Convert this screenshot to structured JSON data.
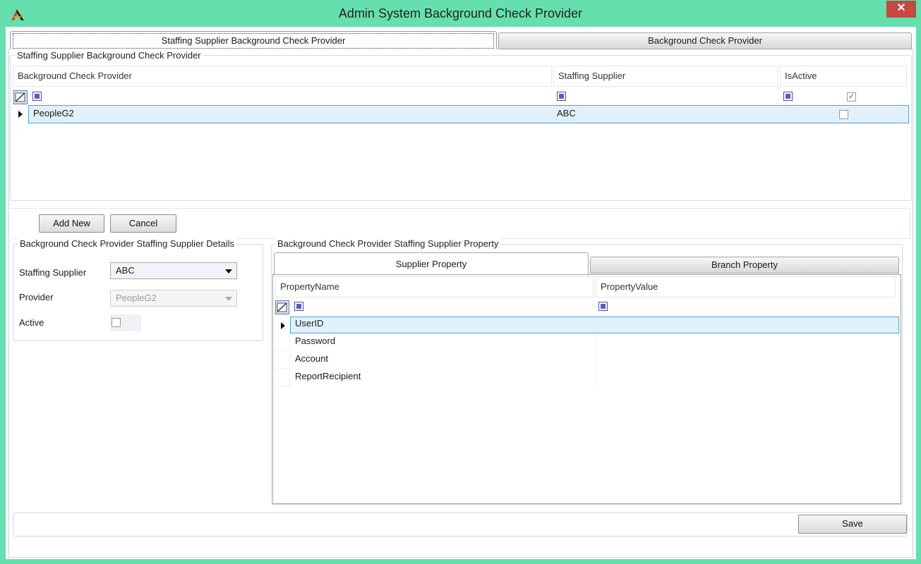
{
  "window": {
    "title": "Admin System Background Check Provider",
    "close_glyph": "✕",
    "app_icon": "app-logo-icon"
  },
  "tabs": {
    "active": "Staffing Supplier Background Check Provider",
    "inactive": "Background Check Provider"
  },
  "grid_group": {
    "label": "Staffing Supplier Background Check Provider",
    "columns": [
      "Background Check Provider",
      "Staffing Supplier",
      "IsActive"
    ],
    "rows": [
      {
        "provider": "PeopleG2",
        "supplier": "ABC",
        "is_active": false
      }
    ]
  },
  "actions": {
    "add_new": "Add New",
    "cancel": "Cancel",
    "save": "Save"
  },
  "details": {
    "label": "Background Check Provider Staffing Supplier Details",
    "staffing_supplier_label": "Staffing Supplier",
    "staffing_supplier_value": "ABC",
    "provider_label": "Provider",
    "provider_value": "PeopleG2",
    "active_label": "Active"
  },
  "property": {
    "label": "Background Check Provider Staffing Supplier Property",
    "tab_active": "Supplier Property",
    "tab_inactive": "Branch Property",
    "columns": [
      "PropertyName",
      "PropertyValue"
    ],
    "rows": [
      "UserID",
      "Password",
      "Account",
      "ReportRecipient"
    ]
  },
  "colors": {
    "titlebar": "#66dfaf",
    "close": "#c7483f",
    "selection": "#e1f1fb",
    "selection_border": "#4e9fdc"
  }
}
